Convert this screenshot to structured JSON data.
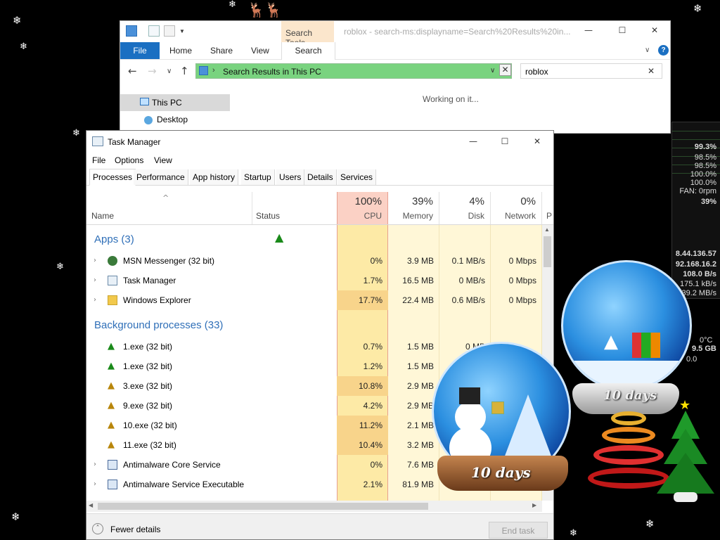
{
  "explorer": {
    "title": "roblox - search-ms:displayname=Search%20Results%20in...",
    "context_tab": "Search Tools",
    "ribbon_tabs": [
      "File",
      "Home",
      "Share",
      "View",
      "Search"
    ],
    "address": "Search Results in This PC",
    "search_value": "roblox",
    "nav_this_pc": "This PC",
    "nav_desktop": "Desktop",
    "status": "Working on it..."
  },
  "gadget": {
    "lines": [
      "99.3%",
      "98.5%",
      "98.5%",
      "100.0%",
      "100.0%",
      "FAN: 0rpm",
      "39%",
      "8.44.136.57",
      "92.168.16.2",
      "108.0 B/s",
      "175.1 kB/s",
      "39.2 MB/s",
      "0°C",
      "9.5 GB",
      "0.0"
    ]
  },
  "taskmanager": {
    "title": "Task Manager",
    "menu": [
      "File",
      "Options",
      "View"
    ],
    "tabs": [
      "Processes",
      "Performance",
      "App history",
      "Startup",
      "Users",
      "Details",
      "Services"
    ],
    "columns": {
      "name": "Name",
      "status": "Status",
      "cpu": {
        "pct": "100%",
        "label": "CPU"
      },
      "memory": {
        "pct": "39%",
        "label": "Memory"
      },
      "disk": {
        "pct": "4%",
        "label": "Disk"
      },
      "network": {
        "pct": "0%",
        "label": "Network"
      },
      "more": "P"
    },
    "groups": {
      "apps": "Apps (3)",
      "background": "Background processes (33)"
    },
    "apps": [
      {
        "name": "MSN Messenger (32 bit)",
        "cpu": "0%",
        "mem": "3.9 MB",
        "disk": "0.1 MB/s",
        "net": "0 Mbps"
      },
      {
        "name": "Task Manager",
        "cpu": "1.7%",
        "mem": "16.5 MB",
        "disk": "0 MB/s",
        "net": "0 Mbps"
      },
      {
        "name": "Windows Explorer",
        "cpu": "17.7%",
        "mem": "22.4 MB",
        "disk": "0.6 MB/s",
        "net": "0 Mbps"
      }
    ],
    "background": [
      {
        "name": "1.exe (32 bit)",
        "cpu": "0.7%",
        "mem": "1.5 MB",
        "disk": "0 MB",
        "net": ""
      },
      {
        "name": "1.exe (32 bit)",
        "cpu": "1.2%",
        "mem": "1.5 MB",
        "disk": "",
        "net": ""
      },
      {
        "name": "3.exe (32 bit)",
        "cpu": "10.8%",
        "mem": "2.9 MB",
        "disk": "",
        "net": ""
      },
      {
        "name": "9.exe (32 bit)",
        "cpu": "4.2%",
        "mem": "2.9 MB",
        "disk": "",
        "net": ""
      },
      {
        "name": "10.exe (32 bit)",
        "cpu": "11.2%",
        "mem": "2.1 MB",
        "disk": "",
        "net": ""
      },
      {
        "name": "11.exe (32 bit)",
        "cpu": "10.4%",
        "mem": "3.2 MB",
        "disk": "",
        "net": ""
      },
      {
        "name": "Antimalware Core Service",
        "cpu": "0%",
        "mem": "7.6 MB",
        "disk": "",
        "net": ""
      },
      {
        "name": "Antimalware Service Executable",
        "cpu": "2.1%",
        "mem": "81.9 MB",
        "disk": "",
        "net": ""
      }
    ],
    "fewer_details": "Fewer details",
    "end_task": "End task"
  },
  "decorations": {
    "globe_left_text": "10 days",
    "globe_right_text": "10 days"
  }
}
